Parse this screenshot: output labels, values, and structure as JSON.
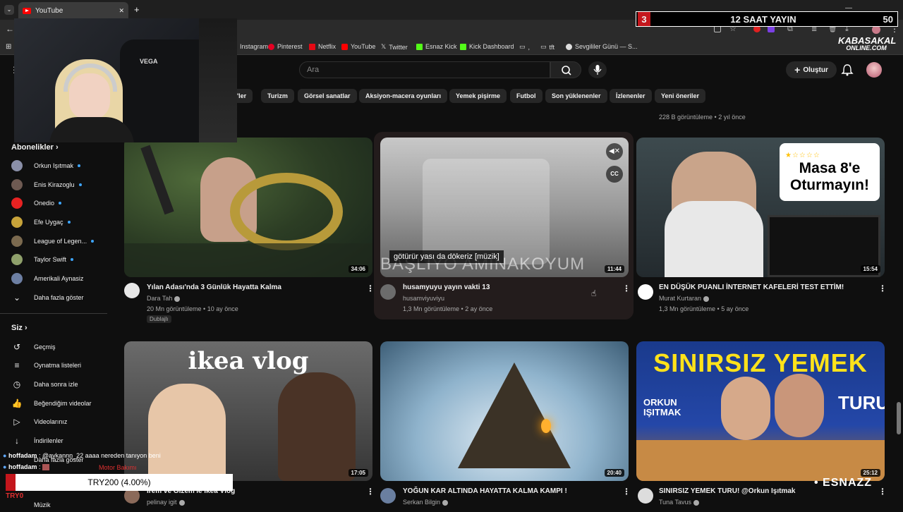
{
  "browser": {
    "tab_title": "YouTube",
    "new_tab": "+",
    "close": "✕",
    "window_controls": {
      "minimize": "—",
      "maximize": "❐",
      "close": "✕"
    },
    "bookmarks": [
      {
        "label": "Instagram",
        "color": "#e1306c"
      },
      {
        "label": "Pinterest",
        "color": "#e60023"
      },
      {
        "label": "Netflix",
        "color": "#e50914"
      },
      {
        "label": "YouTube",
        "color": "#ff0000"
      },
      {
        "label": "Twitter",
        "color": "#ffffff"
      },
      {
        "label": "Esnaz Kick",
        "color": "#53fc18"
      },
      {
        "label": "Kick Dashboard",
        "color": "#53fc18"
      },
      {
        "label": ",",
        "color": "#aaaaaa"
      },
      {
        "label": "tft",
        "color": "#aaaaaa"
      },
      {
        "label": "Sevgililer Günü — S...",
        "color": "#dddddd"
      }
    ]
  },
  "overlay": {
    "number": "3",
    "title": "12 SAAT YAYIN",
    "count": "50",
    "brand_line1": "KABASAKAL",
    "brand_line2": "ONLINE.COM",
    "webcam_brand": "VEGA",
    "esnazz": "• ESNAZZ"
  },
  "header": {
    "search_placeholder": "Ara",
    "create_label": "Oluştur"
  },
  "chips": [
    "x'ler",
    "Turizm",
    "Görsel sanatlar",
    "Aksiyon-macera oyunları",
    "Yemek pişirme",
    "Futbol",
    "Son yüklenenler",
    "İzlenenler",
    "Yeni öneriler"
  ],
  "sidebar": {
    "subscriptions_heading": "Abonelikler",
    "subscriptions": [
      {
        "label": "Orkun Işıtmak",
        "color": "#8a8fa8"
      },
      {
        "label": "Enis Kirazoglu",
        "color": "#6e5a52"
      },
      {
        "label": "Onedio",
        "color": "#e62222"
      },
      {
        "label": "Efe Uygaç",
        "color": "#c7a33a"
      },
      {
        "label": "League of Legen...",
        "color": "#7b6a4f"
      },
      {
        "label": "Taylor Swift",
        "color": "#8fa06b"
      },
      {
        "label": "Amerikali Aynasiz",
        "color": "#6d7fa3"
      }
    ],
    "show_more": "Daha fazla göster",
    "you_heading": "Siz",
    "you_items": [
      {
        "label": "Geçmiş",
        "icon": "↺"
      },
      {
        "label": "Oynatma listeleri",
        "icon": "≡"
      },
      {
        "label": "Daha sonra izle",
        "icon": "◷"
      },
      {
        "label": "Beğendiğim videolar",
        "icon": "👍"
      },
      {
        "label": "Videolarınız",
        "icon": "▷"
      },
      {
        "label": "İndirilenler",
        "icon": "↓"
      }
    ],
    "show_more_2": "Daha fazla göster",
    "music": "Müzik"
  },
  "top_partial": {
    "meta": "228 B görüntüleme • 2 yıl önce"
  },
  "videos": [
    {
      "title": "Yılan Adası'nda 3 Günlük Hayatta Kalma",
      "channel": "Dara Tah",
      "meta": "20 Mn görüntüleme • 10 ay önce",
      "badge": "Dublajlı",
      "duration": "34:06",
      "av": "#e8e8e8"
    },
    {
      "title": "husamyuyu yayın vakti 13",
      "channel": "husamviyuviyu",
      "meta": "1,3 Mn görüntüleme • 2 ay önce",
      "duration": "11:44",
      "caption": "götürür yası da dökeriz [müzik]",
      "thumb_text": "BAŞLIYO AMINAKOYUM",
      "av": "#6c6c6c"
    },
    {
      "title": "EN DÜŞÜK PUANLI İNTERNET KAFELERİ TEST ETTİM!",
      "channel": "Murat Kurtaran",
      "meta": "1,3 Mn görüntüleme • 5 ay önce",
      "duration": "15:54",
      "thumb_text_1": "Masa 8'e",
      "thumb_text_2": "Oturmayın!",
      "thumb_num": "8",
      "av": "#ffffff"
    },
    {
      "title": "İrem ve Gizem'le İkea Vlog",
      "channel": "pelinay igit",
      "meta": "",
      "duration": "17:05",
      "thumb_text": "ikea vlog",
      "av": "#8b6a5a"
    },
    {
      "title": "YOĞUN KAR ALTINDA HAYATTA KALMA KAMPI !",
      "channel": "Serkan Bilgin",
      "meta": "",
      "duration": "20:40",
      "av": "#6a7fa0"
    },
    {
      "title": "SINIRSIZ YEMEK TURU! @Orkun Işıtmak",
      "channel": "Tuna Tavus",
      "meta": "",
      "duration": "25:12",
      "thumb_text": "SINIRSIZ YEMEK",
      "thumb_sub": "TURU!",
      "thumb_name": "ORKUN IŞITMAK",
      "av": "#dddddd"
    }
  ],
  "chat": [
    {
      "user": "hoffadam",
      "text": "@aykannn_22 aaaa nereden tanıyon beni"
    },
    {
      "user": "hoffadam",
      "text": ""
    }
  ],
  "chat_extra": "Motor Bakımı",
  "donation": "TRY200 (4.00%)",
  "donation_prefix": "TRY0"
}
